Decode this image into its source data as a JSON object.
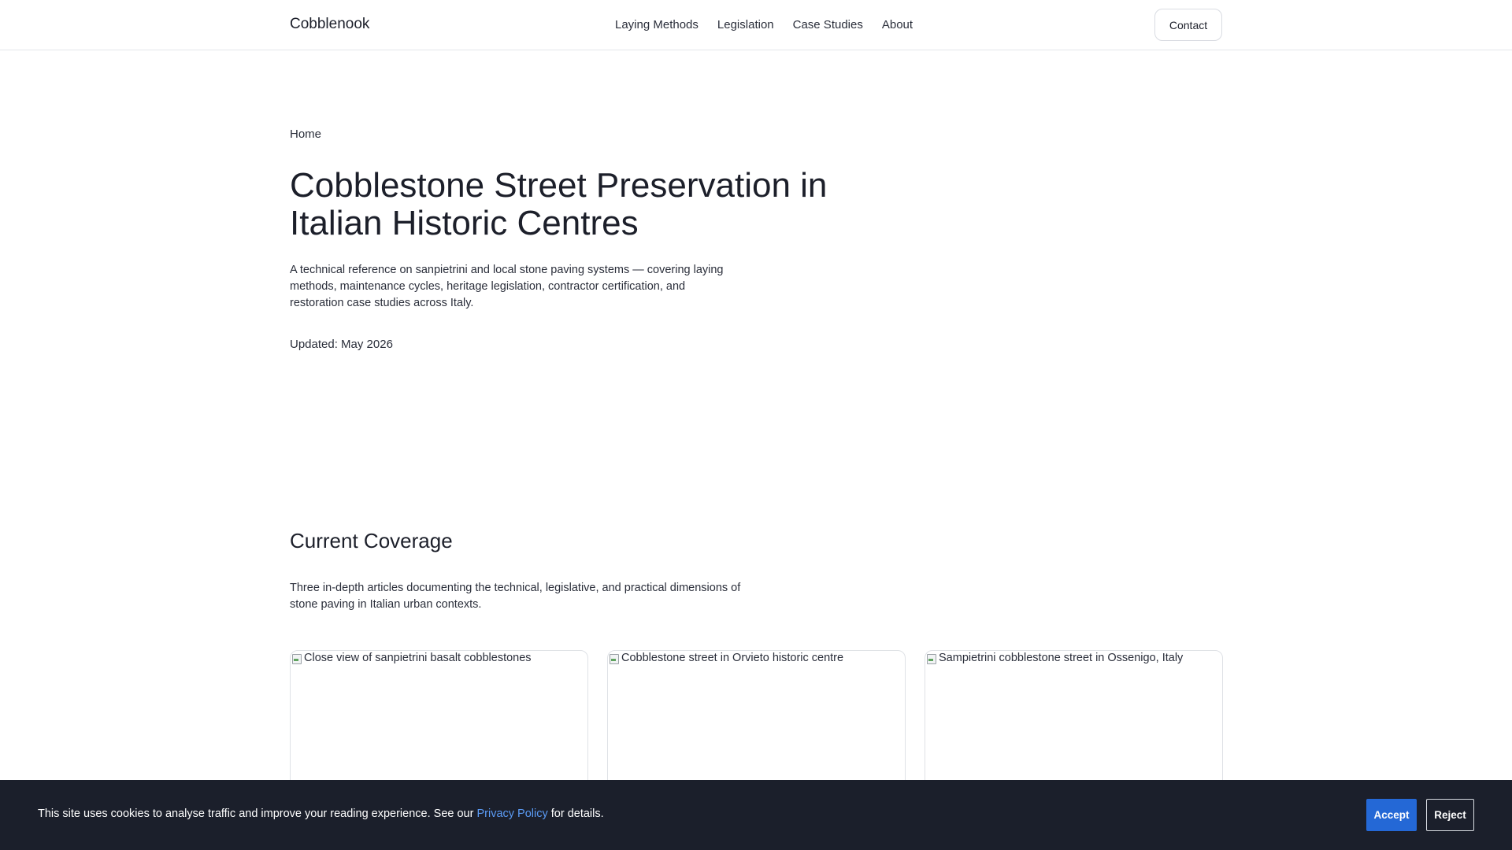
{
  "header": {
    "brand": "Cobblenook",
    "nav": [
      {
        "label": "Laying Methods"
      },
      {
        "label": "Legislation"
      },
      {
        "label": "Case Studies"
      },
      {
        "label": "About"
      }
    ],
    "contact_label": "Contact"
  },
  "hero": {
    "breadcrumb": "Home",
    "title": "Cobblestone Street Preservation in Italian Historic Centres",
    "description": "A technical reference on sanpietrini and local stone paving systems — covering laying methods, maintenance cycles, heritage legislation, contractor certification, and restoration case studies across Italy.",
    "updated": "Updated: May 2026"
  },
  "coverage": {
    "title": "Current Coverage",
    "description": "Three in-depth articles documenting the technical, legislative, and practical dimensions of stone paving in Italian urban contexts.",
    "cards": [
      {
        "image_alt": "Close view of sanpietrini basalt cobblestones",
        "icon": "broken-image-icon"
      },
      {
        "image_alt": "Cobblestone street in Orvieto historic centre",
        "icon": "broken-image-icon"
      },
      {
        "image_alt": "Sampietrini cobblestone street in Ossenigo, Italy",
        "icon": "broken-image-icon"
      }
    ]
  },
  "cookie": {
    "text_before": "This site uses cookies to analyse traffic and improve your reading experience. See our ",
    "link_label": "Privacy Policy",
    "text_after": " for details.",
    "accept_label": "Accept",
    "reject_label": "Reject",
    "accept_color": "#2468d6",
    "bar_color": "#1b1f2b",
    "link_color": "#5b9bf5"
  }
}
